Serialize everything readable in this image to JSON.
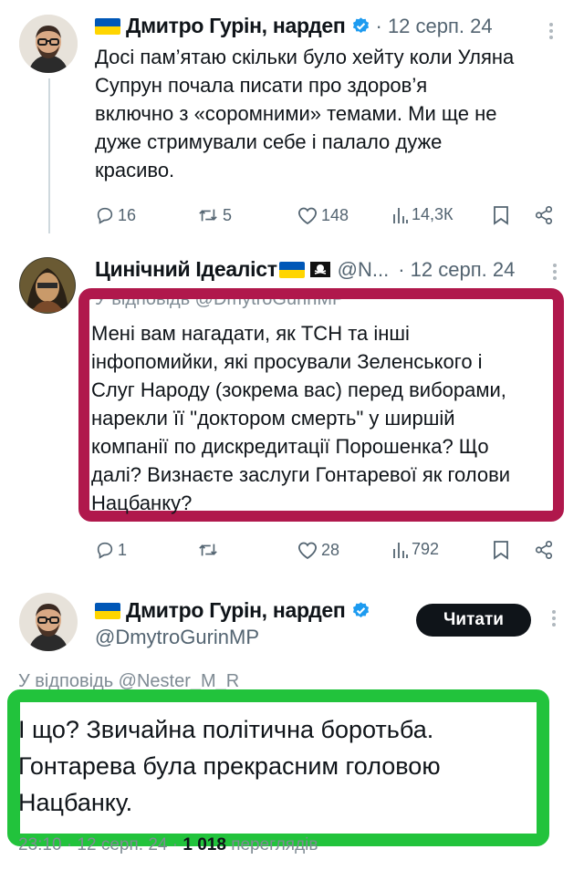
{
  "tweet1": {
    "author_name": "Дмитро Гурін, нардеп",
    "date": "· 12 серп. 24",
    "text_lines": [
      "Досі пам’ятаю скільки було хейту коли Уляна",
      "Супрун почала писати про здоров’я",
      "включно з «соромними» темами. Ми ще не",
      "дуже стримували себе і палало дуже",
      "красиво."
    ],
    "replies": "16",
    "reposts": "5",
    "likes": "148",
    "views": "14,3К"
  },
  "tweet2": {
    "author_name": "Цинічний Ідеаліст",
    "handle": "@N...",
    "date": "· 12 серп. 24",
    "reply_to": "У відповідь @DmytroGurinMP",
    "text_lines": [
      "Мені вам нагадати, як ТСН та інші",
      "інфопомийки, які просували Зеленського і",
      "Слуг Народу (зокрема вас) перед виборами,",
      "нарекли її \"доктором смерть\" у ширшій",
      "компанії по дискредитації Порошенка? Що",
      "далі? Визнаєте заслуги Гонтаревої як голови",
      "Нацбанку?"
    ],
    "replies": "1",
    "reposts": "",
    "likes": "28",
    "views": "792",
    "highlight_color": "#b0184c"
  },
  "tweet3": {
    "author_name": "Дмитро Гурін, нардеп",
    "handle": "@DmytroGurinMP",
    "follow_button": "Читати",
    "reply_to": "У відповідь @Nester_M_R",
    "text_lines": [
      "І що? Звичайна політична боротьба.",
      "Гонтарева була прекрасним головою",
      "Нацбанку."
    ],
    "meta_time": "23:10 · 12 серп. 24 ·",
    "meta_views_count": "1 018",
    "meta_views_label": "переглядів",
    "highlight_color": "#22c33c"
  },
  "colors": {
    "verified": "#1d9bf0",
    "flag_blue": "#0057b7",
    "flag_yellow": "#ffd500",
    "muted": "#536471"
  },
  "icons": [
    "reply-icon",
    "repost-icon",
    "like-icon",
    "views-icon",
    "bookmark-icon",
    "share-icon",
    "verified-badge-icon",
    "pirate-flag-icon",
    "more-icon"
  ]
}
